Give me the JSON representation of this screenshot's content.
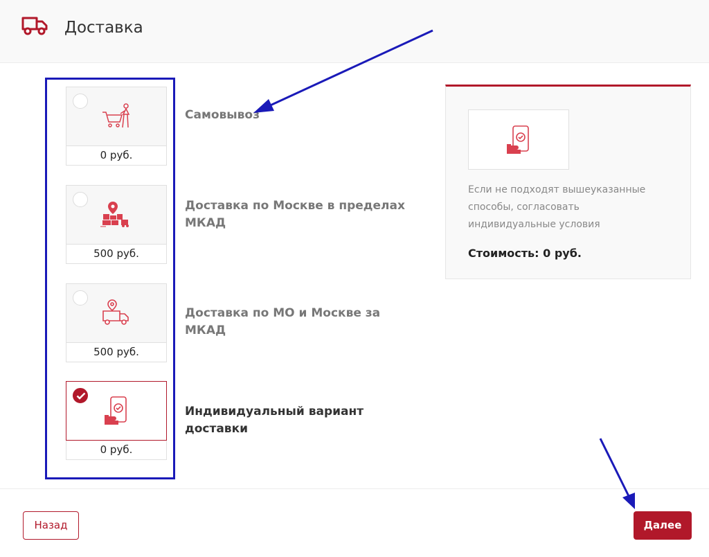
{
  "header": {
    "title": "Доставка",
    "icon": "truck-icon"
  },
  "options": [
    {
      "price": "0 руб.",
      "label": "Самовывоз",
      "icon": "shopping-cart-person-icon",
      "selected": false
    },
    {
      "price": "500 руб.",
      "label": "Доставка по Москве в пределах МКАД",
      "icon": "city-map-pin-icon",
      "selected": false
    },
    {
      "price": "500 руб.",
      "label": "Доставка по МО и Москве за МКАД",
      "icon": "truck-location-icon",
      "selected": false
    },
    {
      "price": "0 руб.",
      "label": "Индивидуальный вариант доставки",
      "icon": "phone-hand-check-icon",
      "selected": true
    }
  ],
  "info_card": {
    "description": "Если не подходят вышеуказанные способы, согласовать индивидуальные условия",
    "cost": "Стоимость: 0 руб.",
    "icon": "phone-hand-check-icon"
  },
  "footer": {
    "back_label": "Назад",
    "next_label": "Далее"
  },
  "colors": {
    "accent": "#b1182a",
    "highlight_box": "#1a1ab8",
    "annotation_arrow": "#1a1ab8"
  }
}
